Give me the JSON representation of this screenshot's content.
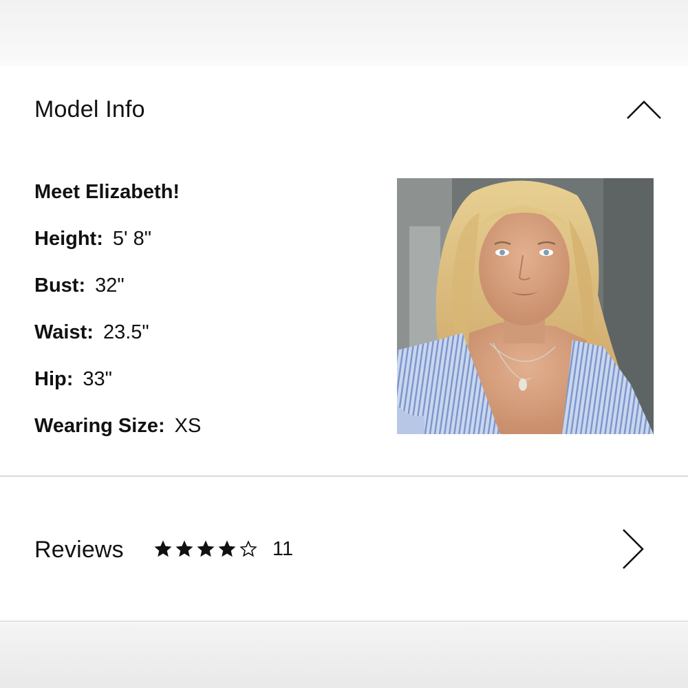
{
  "model_info": {
    "title": "Model Info",
    "toggle_icon": "chevron-up-icon",
    "heading": "Meet Elizabeth!",
    "measurements": [
      {
        "label": "Height:",
        "value": "5' 8\""
      },
      {
        "label": "Bust:",
        "value": "32\""
      },
      {
        "label": "Waist:",
        "value": "23.5\""
      },
      {
        "label": "Hip:",
        "value": "33\""
      },
      {
        "label": "Wearing Size:",
        "value": "XS"
      }
    ]
  },
  "reviews": {
    "title": "Reviews",
    "rating": 4,
    "rating_max": 5,
    "count": "11",
    "open_icon": "chevron-right-icon"
  },
  "colors": {
    "text": "#111111",
    "divider": "#d9d9d9",
    "star": "#111111"
  }
}
